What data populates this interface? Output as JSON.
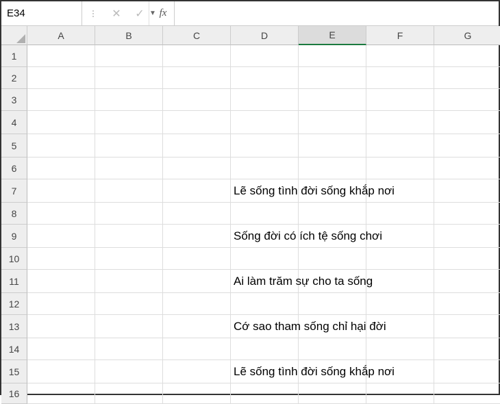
{
  "namebox": {
    "value": "E34"
  },
  "formula_input": {
    "value": ""
  },
  "fx_label": "fx",
  "columns": [
    "A",
    "B",
    "C",
    "D",
    "E",
    "F",
    "G"
  ],
  "active_col": "E",
  "rows": [
    1,
    2,
    3,
    4,
    5,
    6,
    7,
    8,
    9,
    10,
    11,
    12,
    13,
    14,
    15,
    16
  ],
  "row_heights": {
    "1": 32,
    "2": 32,
    "3": 32,
    "4": 34,
    "5": 34,
    "6": 32,
    "7": 34,
    "8": 32,
    "9": 34,
    "10": 32,
    "11": 34,
    "12": 32,
    "13": 34,
    "14": 32,
    "15": 34,
    "16": 30
  },
  "cells": {
    "D7": "Lẽ sống tình đời sống khắp nơi",
    "D9": "Sống đời có ích tệ sống chơi",
    "D11": "Ai làm trăm sự cho ta sống",
    "D13": "Cớ sao tham sống chỉ hại đời",
    "D15": "Lẽ sống tình đời sống khắp nơi"
  }
}
